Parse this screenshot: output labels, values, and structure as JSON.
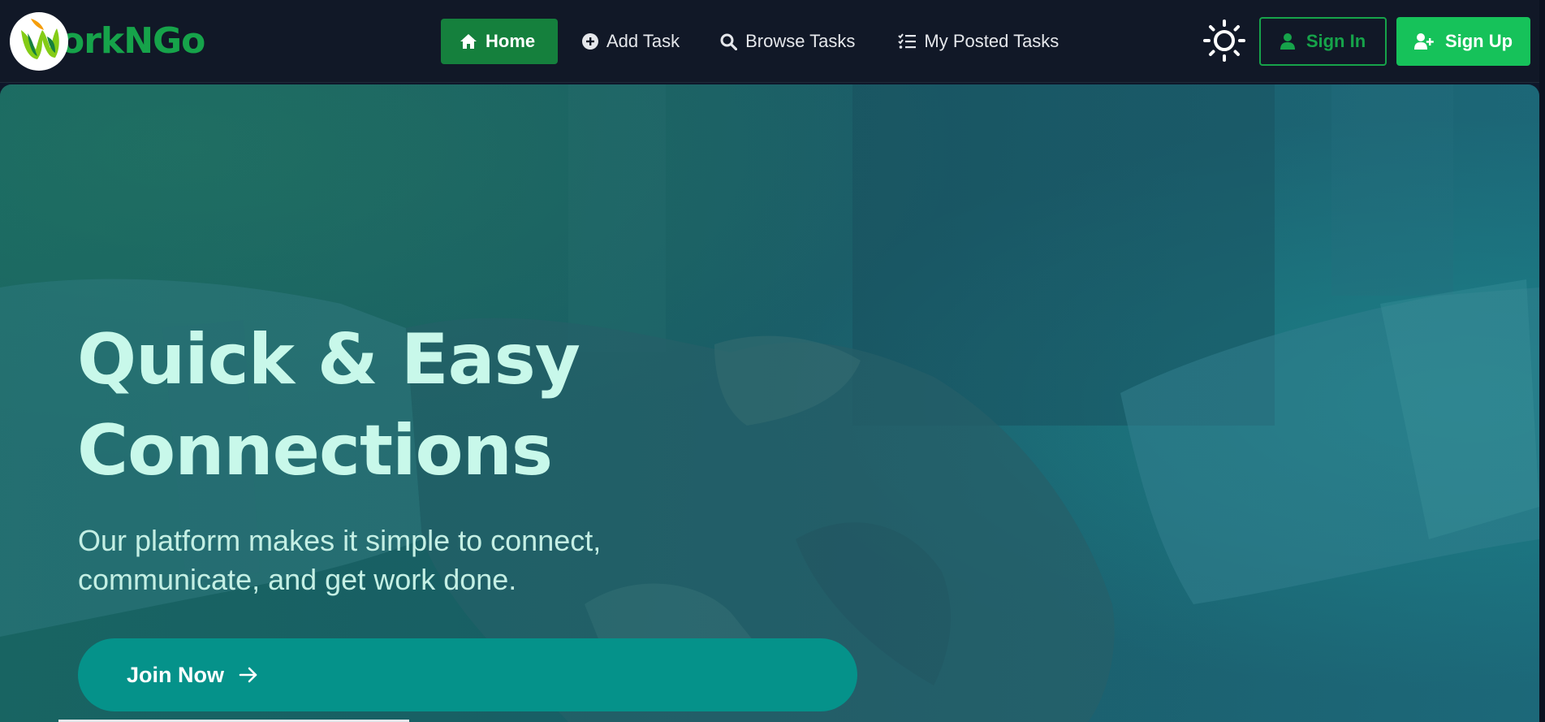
{
  "brand": {
    "name": "orkNGo",
    "logo_icon": "w-leaf-logo"
  },
  "nav": {
    "items": [
      {
        "label": "Home",
        "icon": "home-icon",
        "active": true
      },
      {
        "label": "Add Task",
        "icon": "plus-circle-icon",
        "active": false
      },
      {
        "label": "Browse Tasks",
        "icon": "search-icon",
        "active": false
      },
      {
        "label": "My Posted Tasks",
        "icon": "checklist-icon",
        "active": false
      }
    ],
    "theme_toggle_icon": "sun-icon",
    "sign_in_label": "Sign In",
    "sign_up_label": "Sign Up"
  },
  "hero": {
    "title_line1": "Quick & Easy",
    "title_line2": "Connections",
    "subtitle_line1": "Our platform makes it simple to connect,",
    "subtitle_line2": "communicate, and get work done.",
    "cta_label": "Join Now",
    "cta_icon": "arrow-right-icon",
    "background": "handshake-photo"
  },
  "colors": {
    "navbar_bg": "#111827",
    "accent_green": "#16a34a",
    "signup_green": "#16c25a",
    "active_nav_bg": "#15803d",
    "hero_title": "#c8f8ea",
    "cta_bg": "#05928a"
  }
}
